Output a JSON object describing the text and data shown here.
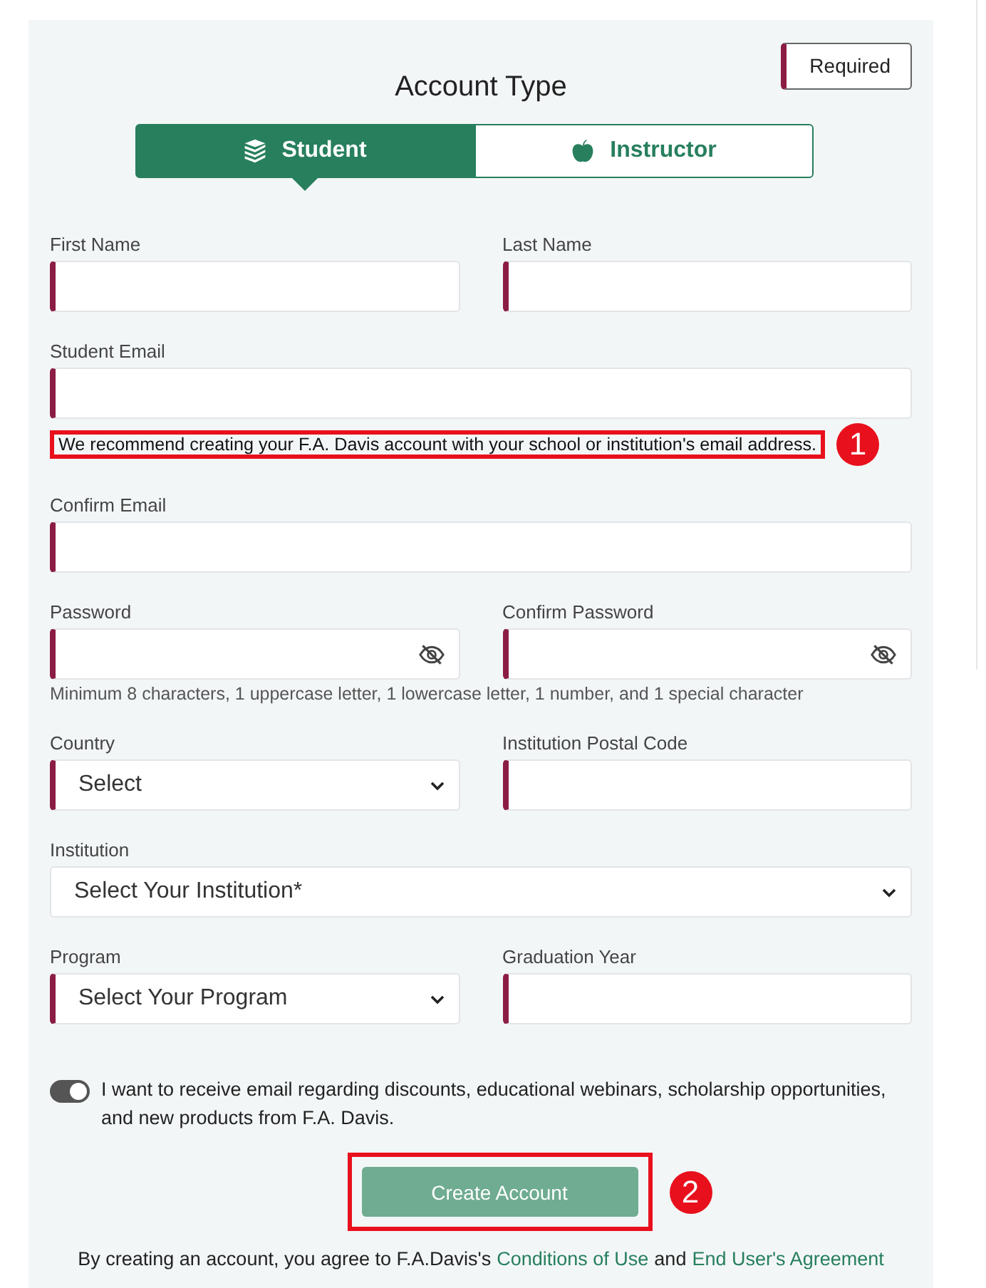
{
  "required_badge": "Required",
  "title": "Account Type",
  "tabs": [
    {
      "label": "Student",
      "selected": true
    },
    {
      "label": "Instructor",
      "selected": false
    }
  ],
  "rows": [
    {
      "fields": [
        {
          "label": "First Name",
          "kind": "text",
          "required": true
        },
        {
          "label": "Last Name",
          "kind": "text",
          "required": true
        }
      ]
    },
    {
      "fields": [
        {
          "label": "Student Email",
          "kind": "text",
          "required": true
        }
      ],
      "hint": "We recommend creating your F.A. Davis account with your school or institution's email address.",
      "hint_callout": "1"
    },
    {
      "fields": [
        {
          "label": "Confirm Email",
          "kind": "text",
          "required": true
        }
      ]
    },
    {
      "fields": [
        {
          "label": "Password",
          "kind": "password",
          "required": true
        },
        {
          "label": "Confirm Password",
          "kind": "password",
          "required": true
        }
      ],
      "hint": "Minimum 8 characters, 1 uppercase letter, 1 lowercase letter, 1 number, and 1 special character"
    },
    {
      "fields": [
        {
          "label": "Country",
          "kind": "select",
          "required": true,
          "value": "Select"
        },
        {
          "label": "Institution Postal Code",
          "kind": "text",
          "required": true
        }
      ]
    },
    {
      "fields": [
        {
          "label": "Institution",
          "kind": "select",
          "required": false,
          "value": "Select Your Institution*"
        }
      ]
    },
    {
      "fields": [
        {
          "label": "Program",
          "kind": "select",
          "required": true,
          "value": "Select Your Program"
        },
        {
          "label": "Graduation Year",
          "kind": "text",
          "required": true
        }
      ]
    }
  ],
  "newsletter": {
    "on": true,
    "label": "I want to receive email regarding discounts, educational webinars, scholarship opportunities, and new products from F.A. Davis."
  },
  "submit": {
    "label": "Create Account",
    "callout": "2"
  },
  "terms": {
    "text": "By creating an account, you agree to F.A.Davis's",
    "link_1": "Conditions of Use",
    "joiner": "and",
    "link_2": "End User's Agreement"
  }
}
